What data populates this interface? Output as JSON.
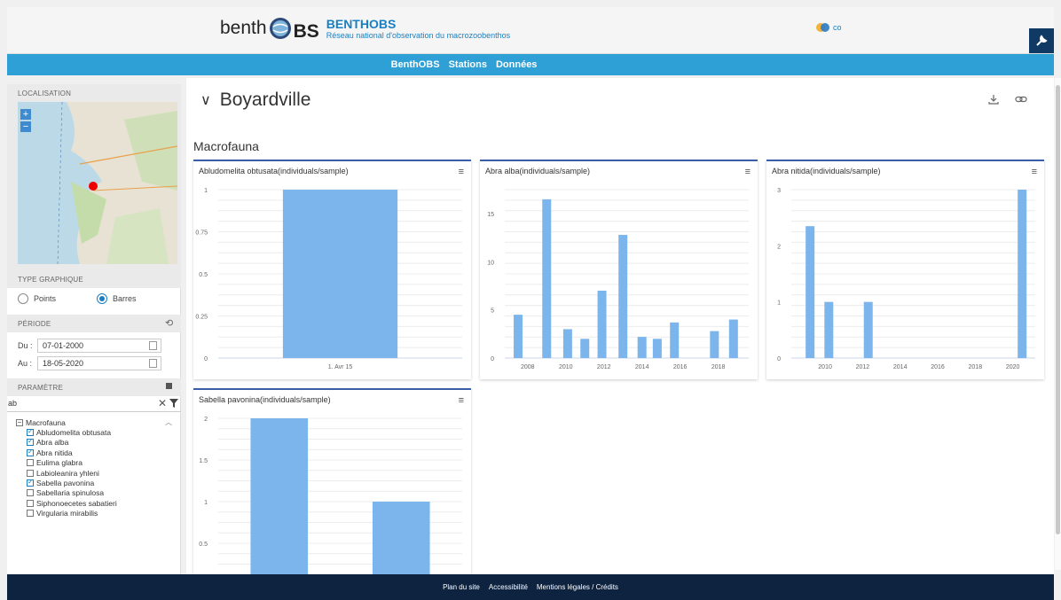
{
  "header": {
    "logo_left": "benth",
    "logo_right": "BS",
    "site_name": "BENTHOBS",
    "site_subtitle": "Réseau national d'observation du macrozoobenthos",
    "partner_text": "co"
  },
  "nav": {
    "items": [
      "BenthOBS",
      "Stations",
      "Données"
    ]
  },
  "left": {
    "localisation_label": "LOCALISATION",
    "zoom_in": "+",
    "zoom_out": "−",
    "type_label": "TYPE GRAPHIQUE",
    "radio_points": "Points",
    "radio_barres": "Barres",
    "selected_type": "Barres",
    "periode_label": "PÉRIODE",
    "du_label": "Du :",
    "du_value": "07-01-2000",
    "au_label": "Au :",
    "au_value": "18-05-2020",
    "parametre_label": "PARAMÈTRE",
    "filter_value": "ab",
    "tree_root": "Macrofauna",
    "species": [
      {
        "label": "Abludomelita obtusata",
        "checked": true
      },
      {
        "label": "Abra alba",
        "checked": true
      },
      {
        "label": "Abra nitida",
        "checked": true
      },
      {
        "label": "Eulima glabra",
        "checked": false
      },
      {
        "label": "Labioleanira yhleni",
        "checked": false
      },
      {
        "label": "Sabella pavonina",
        "checked": true
      },
      {
        "label": "Sabellaria spinulosa",
        "checked": false
      },
      {
        "label": "Siphonoecetes sabatieri",
        "checked": false
      },
      {
        "label": "Virgularia mirabilis",
        "checked": false
      }
    ]
  },
  "main": {
    "station": "Boyardville",
    "group": "Macrofauna",
    "bar_color": "#7cb5ec"
  },
  "chart_data": [
    {
      "type": "bar",
      "title": "Abludomelita obtusata(individuals/sample)",
      "categories": [
        "1. Avr 15"
      ],
      "values": [
        1
      ],
      "ylim": [
        0,
        1
      ],
      "yticks": [
        0,
        0.25,
        0.5,
        0.75,
        1
      ],
      "ytick_labels": [
        "0",
        "0.25",
        "0.5",
        "0.75",
        "1"
      ],
      "xticks": [],
      "xtick_labels": [],
      "xlim": null
    },
    {
      "type": "bar",
      "title": "Abra alba(individuals/sample)",
      "x": [
        2007.5,
        2009,
        2010.1,
        2011,
        2011.9,
        2013,
        2014,
        2014.8,
        2015.7,
        2017.8,
        2018.8
      ],
      "values": [
        4.5,
        16.5,
        3,
        2,
        7,
        12.8,
        2.2,
        2,
        3.7,
        2.8,
        4
      ],
      "ylim": [
        0,
        17.5
      ],
      "yticks": [
        0,
        5,
        10,
        15
      ],
      "ytick_labels": [
        "0",
        "5",
        "10",
        "15"
      ],
      "xlim": [
        2006.8,
        2019.6
      ],
      "xticks": [
        2008,
        2010,
        2012,
        2014,
        2016,
        2018
      ],
      "xtick_labels": [
        "2008",
        "2010",
        "2012",
        "2014",
        "2016",
        "2018"
      ]
    },
    {
      "type": "bar",
      "title": "Abra nitida(individuals/sample)",
      "x": [
        2009.2,
        2010.2,
        2012.3,
        2020.5
      ],
      "values": [
        2.35,
        1,
        1,
        3
      ],
      "ylim": [
        0,
        3
      ],
      "yticks": [
        0,
        1,
        2,
        3
      ],
      "ytick_labels": [
        "0",
        "1",
        "2",
        "3"
      ],
      "xlim": [
        2008.2,
        2021.2
      ],
      "xticks": [
        2010,
        2012,
        2014,
        2016,
        2018,
        2020
      ],
      "xtick_labels": [
        "2010",
        "2012",
        "2014",
        "2016",
        "2018",
        "2020"
      ]
    },
    {
      "type": "bar",
      "title": "Sabella pavonina(individuals/sample)",
      "categories": [
        "",
        ""
      ],
      "values": [
        2,
        1
      ],
      "ylim": [
        0,
        2
      ],
      "yticks": [
        0.5,
        1,
        1.5,
        2
      ],
      "ytick_labels": [
        "0.5",
        "1",
        "1.5",
        "2"
      ],
      "xticks": [],
      "xtick_labels": [],
      "xlim": null
    }
  ],
  "footer": {
    "links": [
      "Plan du site",
      "Accessibilité",
      "Mentions légales / Crédits"
    ]
  }
}
